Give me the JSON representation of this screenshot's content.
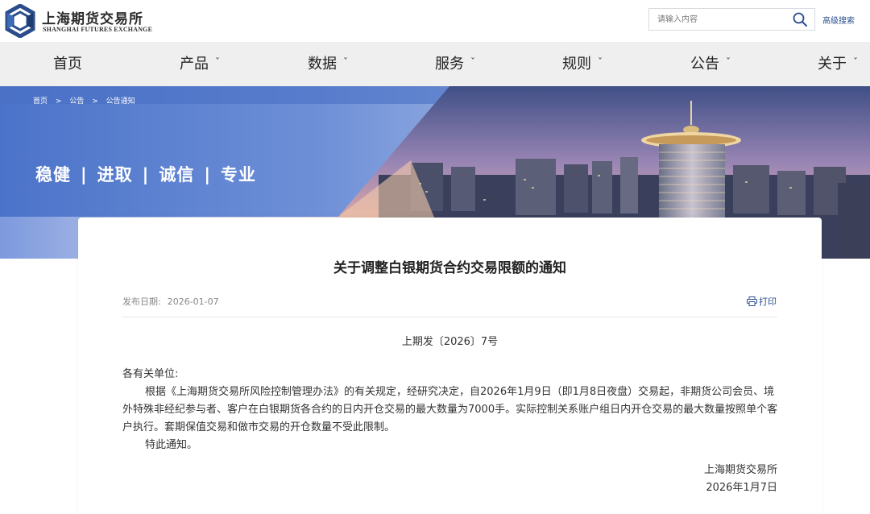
{
  "header": {
    "logo_cn": "上海期货交易所",
    "logo_en": "SHANGHAI FUTURES EXCHANGE",
    "search_placeholder": "请输入内容",
    "advanced_search": "高级搜索",
    "icons": [
      "shfe-logo-icon",
      "search-icon"
    ]
  },
  "nav": {
    "items": [
      {
        "label": "首页",
        "has_dropdown": false
      },
      {
        "label": "产品",
        "has_dropdown": true
      },
      {
        "label": "数据",
        "has_dropdown": true
      },
      {
        "label": "服务",
        "has_dropdown": true
      },
      {
        "label": "规则",
        "has_dropdown": true
      },
      {
        "label": "公告",
        "has_dropdown": true
      },
      {
        "label": "关于",
        "has_dropdown": true
      }
    ]
  },
  "banner": {
    "breadcrumb": [
      "首页",
      ">",
      "公告",
      ">",
      "公告通知"
    ],
    "slogan": [
      "稳健",
      "进取",
      "诚信",
      "专业"
    ],
    "slogan_separator": "|"
  },
  "article": {
    "title": "关于调整白银期货合约交易限额的通知",
    "date_label": "发布日期:",
    "date": "2026-01-07",
    "print_label": "打印",
    "doc_number": "上期发〔2026〕7号",
    "salutation": "各有关单位:",
    "paragraphs": [
      "根据《上海期货交易所风险控制管理办法》的有关规定，经研究决定，自2026年1月9日（即1月8日夜盘）交易起，非期货公司会员、境外特殊非经纪参与者、客户在白银期货各合约的日内开仓交易的最大数量为7000手。实际控制关系账户组日内开仓交易的最大数量按照单个客户执行。套期保值交易和做市交易的开仓数量不受此限制。",
      "特此通知。"
    ],
    "signature": "上海期货交易所",
    "signature_date": "2026年1月7日"
  },
  "colors": {
    "nav_bg": "#efefef",
    "link_blue": "#2a4e8f",
    "banner_blue": "#5a7fd0"
  }
}
